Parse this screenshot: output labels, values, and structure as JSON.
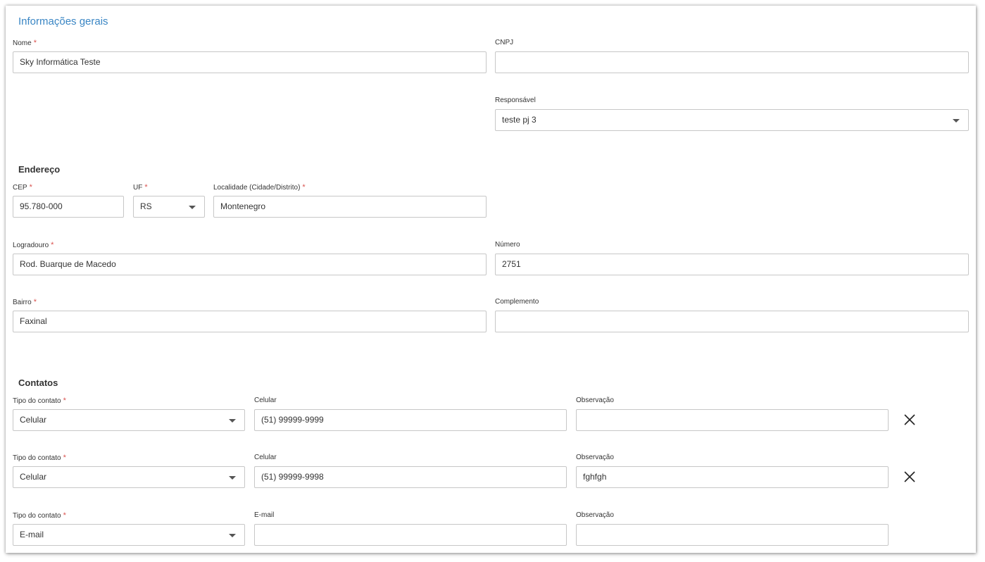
{
  "section_title": "Informações gerais",
  "general": {
    "nome": {
      "label": "Nome",
      "value": "Sky Informática Teste"
    },
    "cnpj": {
      "label": "CNPJ",
      "value": ""
    },
    "responsavel": {
      "label": "Responsável",
      "value": "teste pj 3"
    }
  },
  "endereco": {
    "title": "Endereço",
    "cep": {
      "label": "CEP",
      "value": "95.780-000"
    },
    "uf": {
      "label": "UF",
      "value": "RS"
    },
    "localidade": {
      "label": "Localidade (Cidade/Distrito)",
      "value": "Montenegro"
    },
    "logradouro": {
      "label": "Logradouro",
      "value": "Rod. Buarque de Macedo"
    },
    "numero": {
      "label": "Número",
      "value": "2751"
    },
    "bairro": {
      "label": "Bairro",
      "value": "Faxinal"
    },
    "complemento": {
      "label": "Complemento",
      "value": ""
    }
  },
  "contatos": {
    "title": "Contatos",
    "rows": [
      {
        "tipo_label": "Tipo do contato",
        "tipo_value": "Celular",
        "valor_label": "Celular",
        "valor_value": "(51) 99999-9999",
        "obs_label": "Observação",
        "obs_value": ""
      },
      {
        "tipo_label": "Tipo do contato",
        "tipo_value": "Celular",
        "valor_label": "Celular",
        "valor_value": "(51) 99999-9998",
        "obs_label": "Observação",
        "obs_value": "fghfgh"
      },
      {
        "tipo_label": "Tipo do contato",
        "tipo_value": "E-mail",
        "valor_label": "E-mail",
        "valor_value": "",
        "obs_label": "Observação",
        "obs_value": ""
      }
    ]
  },
  "required_marker": "*",
  "colors": {
    "accent": "#3a86c4",
    "required": "#d9534f",
    "border": "#c7c7c7"
  },
  "icons": {
    "remove": "close-icon",
    "dropdown": "chevron-down-icon"
  }
}
